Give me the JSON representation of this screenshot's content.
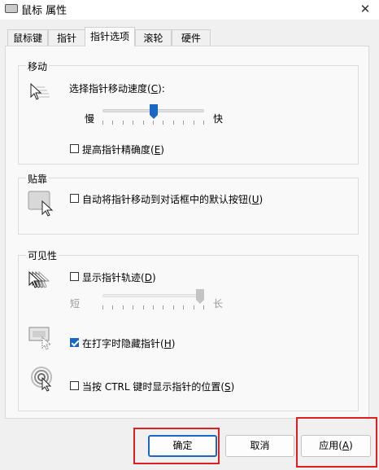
{
  "window": {
    "title": "鼠标 属性",
    "close_glyph": "✕"
  },
  "tabs": [
    "鼠标键",
    "指针",
    "指针选项",
    "滚轮",
    "硬件"
  ],
  "motion": {
    "group_title": "移动",
    "speed_label_prefix": "选择指针移动速度(",
    "speed_label_key": "C",
    "speed_label_suffix": "):",
    "slow": "慢",
    "fast": "快",
    "speed_value": 0.5,
    "precision_prefix": "提高指针精确度(",
    "precision_key": "E",
    "precision_suffix": ")",
    "precision_checked": false
  },
  "snap": {
    "group_title": "贴靠",
    "label_prefix": "自动将指针移动到对话框中的默认按钮(",
    "label_key": "U",
    "label_suffix": ")",
    "checked": false
  },
  "visibility": {
    "group_title": "可见性",
    "trails_prefix": "显示指针轨迹(",
    "trails_key": "D",
    "trails_suffix": ")",
    "trails_checked": false,
    "short": "短",
    "long": "长",
    "trails_value": 1.0,
    "hide_prefix": "在打字时隐藏指针(",
    "hide_key": "H",
    "hide_suffix": ")",
    "hide_checked": true,
    "ctrl_prefix": "当按 CTRL 键时显示指针的位置(",
    "ctrl_key": "S",
    "ctrl_suffix": ")",
    "ctrl_checked": false
  },
  "buttons": {
    "ok": "确定",
    "cancel": "取消",
    "apply_prefix": "应用(",
    "apply_key": "A",
    "apply_suffix": ")"
  },
  "colors": {
    "accent": "#1a67c4",
    "highlight": "#e02020"
  }
}
